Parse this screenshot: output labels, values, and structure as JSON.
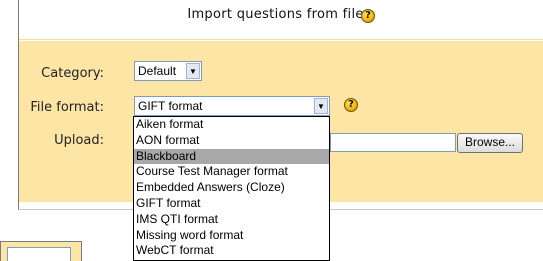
{
  "header": {
    "title": "Import questions from file",
    "help_symbol": "?"
  },
  "form": {
    "category_label": "Category:",
    "category_value": "Default",
    "format_label": "File format:",
    "format_value": "GIFT format",
    "format_help_symbol": "?",
    "upload_label": "Upload:",
    "upload_value": "",
    "browse_label": "Browse..."
  },
  "format_options": [
    "Aiken format",
    "AON format",
    "Blackboard",
    "Course Test Manager format",
    "Embedded Answers (Cloze)",
    "GIFT format",
    "IMS QTI format",
    "Missing word format",
    "WebCT format"
  ],
  "highlighted_option": "Blackboard",
  "colors": {
    "panel_body": "#fde5a6",
    "highlight": "#a8a8a8"
  }
}
